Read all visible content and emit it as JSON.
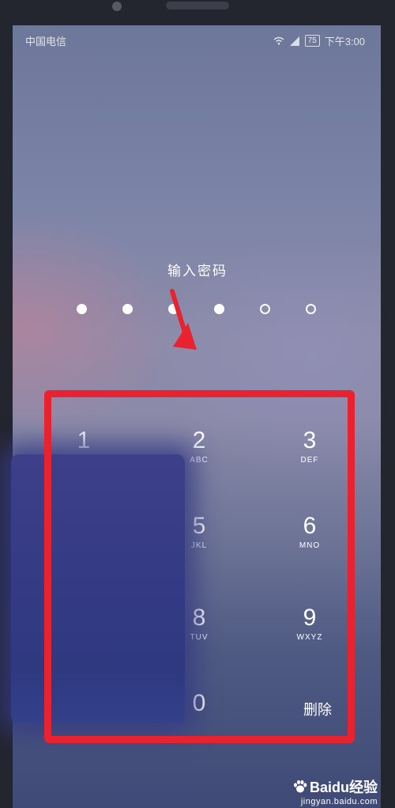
{
  "status_bar": {
    "carrier": "中国电信",
    "battery": "75",
    "time": "下午3:00"
  },
  "lock_screen": {
    "title": "输入密码",
    "pin_length": 6,
    "pin_entered": 4
  },
  "keypad": {
    "keys": [
      {
        "digit": "1",
        "letters": ""
      },
      {
        "digit": "2",
        "letters": "ABC"
      },
      {
        "digit": "3",
        "letters": "DEF"
      },
      {
        "digit": "5",
        "letters": "JKL"
      },
      {
        "digit": "6",
        "letters": "MNO"
      },
      {
        "digit": "8",
        "letters": "TUV"
      },
      {
        "digit": "9",
        "letters": "WXYZ"
      },
      {
        "digit": "0",
        "letters": ""
      }
    ],
    "delete_label": "删除"
  },
  "watermark": {
    "brand": "Baidu经验",
    "url": "jingyan.baidu.com"
  },
  "colors": {
    "annotation_red": "#e8232f",
    "text": "#ffffff"
  }
}
